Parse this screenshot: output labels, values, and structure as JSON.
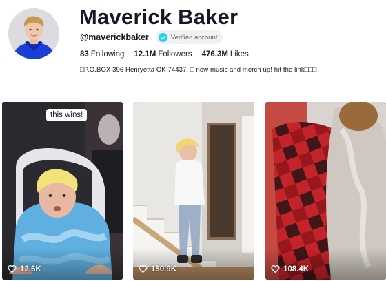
{
  "profile": {
    "name": "Maverick Baker",
    "handle": "@maverickbaker",
    "verified_label": "Verified account",
    "stats": {
      "following_count": "83",
      "following_label": "Following",
      "followers_count": "12.1M",
      "followers_label": "Followers",
      "likes_count": "476.3M",
      "likes_label": "Likes"
    },
    "bio": "□P.O.BOX 396 Henryetta OK 74437. □ new music and merch up! hit the link□□□"
  },
  "videos": [
    {
      "views": "12.6K",
      "caption_sticker": "this wins!"
    },
    {
      "views": "150.9K"
    },
    {
      "views": "108.4K"
    }
  ],
  "colors": {
    "verified_badge": "#20d5ec",
    "text_primary": "#161823",
    "hoodie_blue": "#1a3fd6"
  },
  "icons": {
    "verified": "check-circle-icon",
    "views": "heart-icon"
  }
}
